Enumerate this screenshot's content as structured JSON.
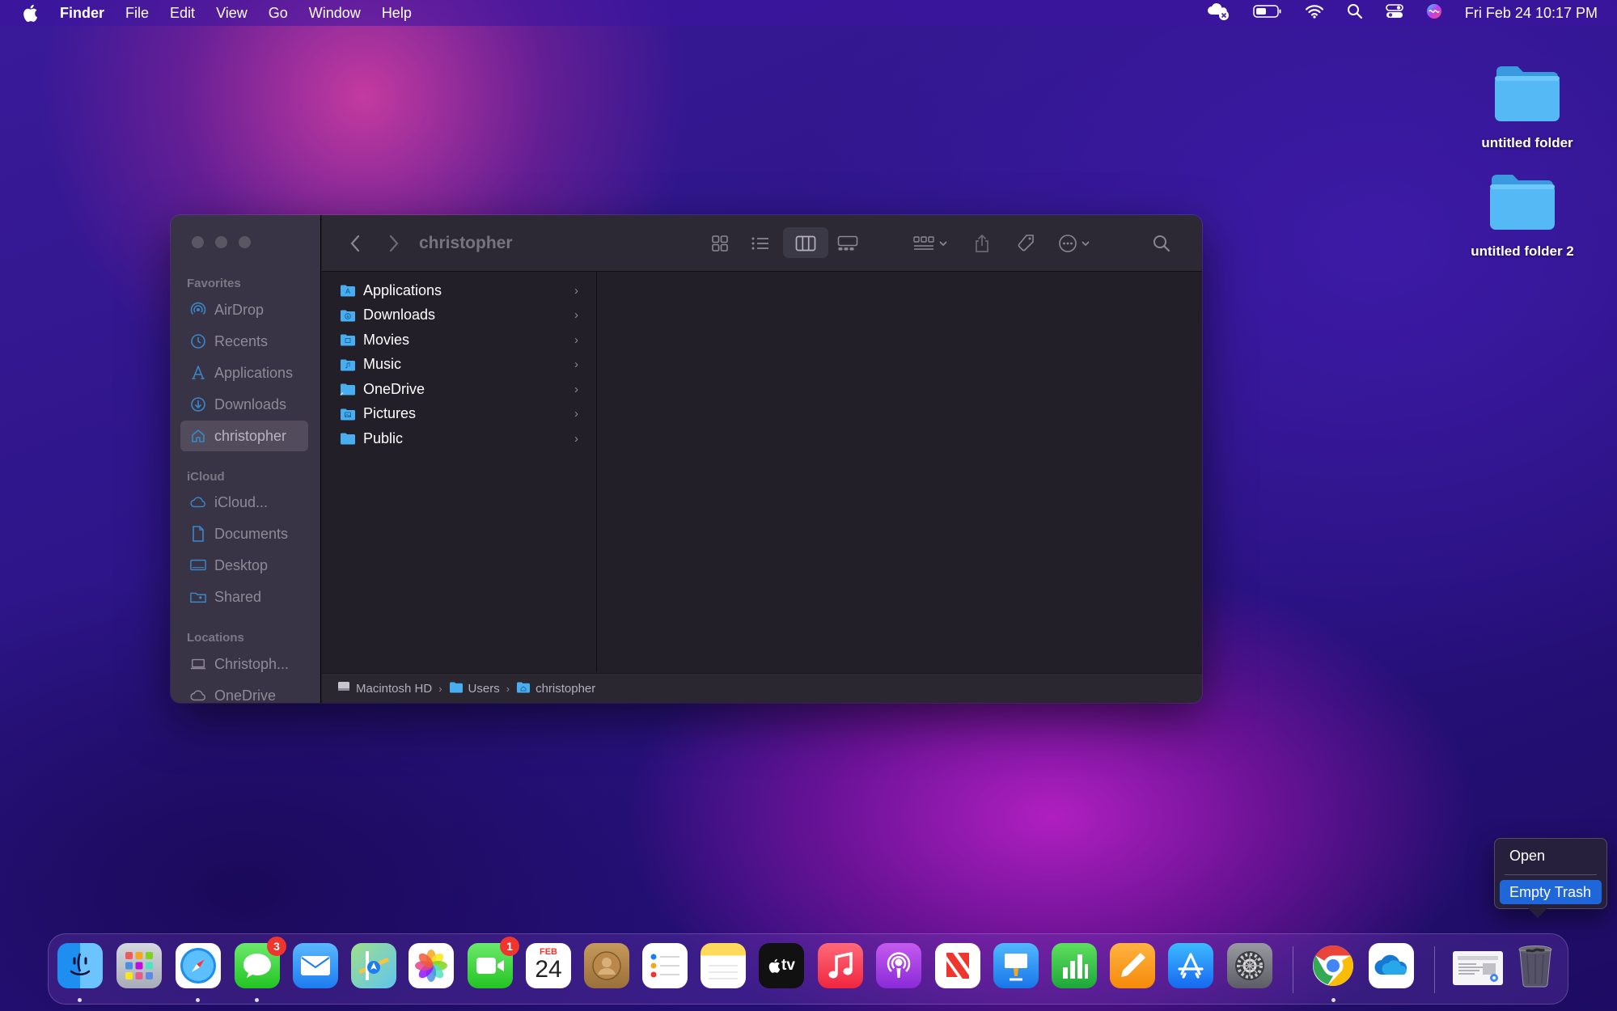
{
  "menubar": {
    "app_name": "Finder",
    "menus": [
      "File",
      "Edit",
      "View",
      "Go",
      "Window",
      "Help"
    ],
    "clock": "Fri Feb 24  10:17 PM"
  },
  "desktop": {
    "icons": [
      {
        "label": "untitled folder"
      },
      {
        "label": "untitled folder 2"
      }
    ]
  },
  "finder": {
    "title": "christopher",
    "sidebar": {
      "favorites_header": "Favorites",
      "favorites": [
        "AirDrop",
        "Recents",
        "Applications",
        "Downloads",
        "christopher"
      ],
      "selected": "christopher",
      "icloud_header": "iCloud",
      "icloud": [
        "iCloud...",
        "Documents",
        "Desktop",
        "Shared"
      ],
      "locations_header": "Locations",
      "locations": [
        "Christoph...",
        "OneDrive"
      ]
    },
    "items": [
      "Applications",
      "Downloads",
      "Movies",
      "Music",
      "OneDrive",
      "Pictures",
      "Public"
    ],
    "path": [
      "Macintosh HD",
      "Users",
      "christopher"
    ]
  },
  "dock": {
    "apps": [
      {
        "name": "Finder",
        "running": true
      },
      {
        "name": "Launchpad",
        "running": false
      },
      {
        "name": "Safari",
        "running": true
      },
      {
        "name": "Messages",
        "running": true,
        "badge": "3"
      },
      {
        "name": "Mail",
        "running": false
      },
      {
        "name": "Maps",
        "running": false
      },
      {
        "name": "Photos",
        "running": false
      },
      {
        "name": "FaceTime",
        "running": false,
        "badge": "1"
      },
      {
        "name": "Calendar",
        "running": false,
        "month": "FEB",
        "day": "24"
      },
      {
        "name": "Contacts",
        "running": false
      },
      {
        "name": "Reminders",
        "running": false
      },
      {
        "name": "Notes",
        "running": false
      },
      {
        "name": "TV",
        "running": false,
        "label": "tv"
      },
      {
        "name": "Music",
        "running": false
      },
      {
        "name": "Podcasts",
        "running": false
      },
      {
        "name": "News",
        "running": false
      },
      {
        "name": "Keynote",
        "running": false
      },
      {
        "name": "Numbers",
        "running": false
      },
      {
        "name": "Pages",
        "running": false
      },
      {
        "name": "App Store",
        "running": false
      },
      {
        "name": "System Settings",
        "running": false
      },
      {
        "name": "Chrome",
        "running": true
      },
      {
        "name": "OneDrive",
        "running": false
      },
      {
        "name": "Chrome Document",
        "running": false
      },
      {
        "name": "Trash",
        "running": false
      }
    ]
  },
  "context_menu": {
    "open": "Open",
    "empty_trash": "Empty Trash"
  },
  "colors": {
    "accent": "#1f66d9",
    "folder": "#48aef0",
    "badge": "#f0352e"
  }
}
